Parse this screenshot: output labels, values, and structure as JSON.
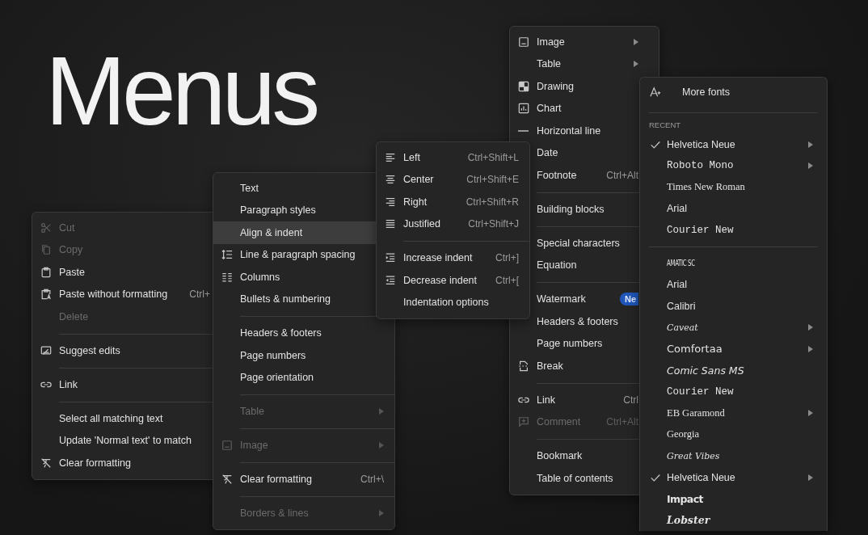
{
  "title": "Menus",
  "menus": [
    {
      "items": [
        {
          "kind": "item",
          "label": "Cut",
          "disabled": true
        },
        {
          "kind": "item",
          "label": "Copy",
          "disabled": true
        },
        {
          "kind": "item",
          "label": "Paste",
          "disabled": false
        },
        {
          "kind": "item",
          "label": "Paste without formatting",
          "shortcut": "Ctrl+",
          "disabled": false
        },
        {
          "kind": "item",
          "label": "Delete",
          "disabled": true
        },
        {
          "kind": "separator"
        },
        {
          "kind": "item",
          "label": "Suggest edits",
          "disabled": false
        },
        {
          "kind": "separator"
        },
        {
          "kind": "item",
          "label": "Link",
          "disabled": false
        },
        {
          "kind": "separator"
        },
        {
          "kind": "item",
          "label": "Select all matching text",
          "disabled": false
        },
        {
          "kind": "item",
          "label": "Update 'Normal text' to match",
          "disabled": false
        },
        {
          "kind": "item",
          "label": "Clear formatting",
          "disabled": false
        }
      ]
    },
    {
      "items": [
        {
          "kind": "item",
          "label": "Text",
          "disabled": false,
          "selected": false
        },
        {
          "kind": "item",
          "label": "Paragraph styles",
          "disabled": false,
          "selected": false
        },
        {
          "kind": "item",
          "label": "Align & indent",
          "disabled": false,
          "selected": true
        },
        {
          "kind": "item",
          "label": "Line & paragraph spacing",
          "disabled": false,
          "selected": false
        },
        {
          "kind": "item",
          "label": "Columns",
          "disabled": false,
          "selected": false
        },
        {
          "kind": "item",
          "label": "Bullets & numbering",
          "disabled": false,
          "selected": false
        },
        {
          "kind": "separator"
        },
        {
          "kind": "item",
          "label": "Headers & footers",
          "disabled": false,
          "selected": false
        },
        {
          "kind": "item",
          "label": "Page numbers",
          "disabled": false,
          "selected": false
        },
        {
          "kind": "item",
          "label": "Page orientation",
          "disabled": false,
          "selected": false
        },
        {
          "kind": "separator"
        },
        {
          "kind": "item",
          "label": "Table",
          "disabled": true,
          "selected": false,
          "submenu": true
        },
        {
          "kind": "separator"
        },
        {
          "kind": "item",
          "label": "Image",
          "disabled": true,
          "selected": false,
          "submenu": true
        },
        {
          "kind": "separator"
        },
        {
          "kind": "item",
          "label": "Clear formatting",
          "shortcut": "Ctrl+\\",
          "disabled": false,
          "selected": false
        },
        {
          "kind": "separator"
        },
        {
          "kind": "item",
          "label": "Borders & lines",
          "disabled": true,
          "selected": false,
          "submenu": true
        }
      ]
    },
    {
      "items": [
        {
          "kind": "item",
          "label": "Left",
          "shortcut": "Ctrl+Shift+L",
          "disabled": false
        },
        {
          "kind": "item",
          "label": "Center",
          "shortcut": "Ctrl+Shift+E",
          "disabled": false
        },
        {
          "kind": "item",
          "label": "Right",
          "shortcut": "Ctrl+Shift+R",
          "disabled": false
        },
        {
          "kind": "item",
          "label": "Justified",
          "shortcut": "Ctrl+Shift+J",
          "disabled": false
        },
        {
          "kind": "separator"
        },
        {
          "kind": "item",
          "label": "Increase indent",
          "shortcut": "Ctrl+]",
          "disabled": false
        },
        {
          "kind": "item",
          "label": "Decrease indent",
          "shortcut": "Ctrl+[",
          "disabled": false
        },
        {
          "kind": "item",
          "label": "Indentation options",
          "disabled": false
        }
      ]
    },
    {
      "items": [
        {
          "kind": "item",
          "label": "Image",
          "disabled": false,
          "submenu": true
        },
        {
          "kind": "item",
          "label": "Table",
          "disabled": false,
          "submenu": true
        },
        {
          "kind": "item",
          "label": "Drawing",
          "disabled": false
        },
        {
          "kind": "item",
          "label": "Chart",
          "disabled": false
        },
        {
          "kind": "item",
          "label": "Horizontal line",
          "disabled": false
        },
        {
          "kind": "item",
          "label": "Date",
          "disabled": false
        },
        {
          "kind": "item",
          "label": "Footnote",
          "shortcut": "Ctrl+Alt",
          "disabled": false
        },
        {
          "kind": "separator"
        },
        {
          "kind": "item",
          "label": "Building blocks",
          "disabled": false
        },
        {
          "kind": "separator"
        },
        {
          "kind": "item",
          "label": "Special characters",
          "disabled": false
        },
        {
          "kind": "item",
          "label": "Equation",
          "disabled": false
        },
        {
          "kind": "separator"
        },
        {
          "kind": "item",
          "label": "Watermark",
          "badge": "Ne",
          "disabled": false
        },
        {
          "kind": "item",
          "label": "Headers & footers",
          "disabled": false
        },
        {
          "kind": "item",
          "label": "Page numbers",
          "disabled": false
        },
        {
          "kind": "item",
          "label": "Break",
          "disabled": false
        },
        {
          "kind": "separator"
        },
        {
          "kind": "item",
          "label": "Link",
          "shortcut": "Ctrl",
          "disabled": false
        },
        {
          "kind": "item",
          "label": "Comment",
          "shortcut": "Ctrl+Alt",
          "disabled": true
        },
        {
          "kind": "separator"
        },
        {
          "kind": "item",
          "label": "Bookmark",
          "disabled": false
        },
        {
          "kind": "item",
          "label": "Table of contents",
          "disabled": false
        }
      ]
    },
    {
      "items": [
        {
          "kind": "large",
          "label": "More fonts",
          "disabled": false
        },
        {
          "kind": "separator"
        },
        {
          "kind": "header",
          "label": "RECENT"
        },
        {
          "kind": "sans",
          "label": "Helvetica Neue",
          "checked": true,
          "submenu": true,
          "disabled": false
        },
        {
          "kind": "mono",
          "label": "Roboto Mono",
          "checked": false,
          "submenu": true,
          "disabled": false
        },
        {
          "kind": "serif",
          "label": "Times New Roman",
          "checked": false,
          "disabled": false
        },
        {
          "kind": "sans",
          "label": "Arial",
          "checked": false,
          "disabled": false
        },
        {
          "kind": "mono",
          "label": "Courier New",
          "checked": false,
          "disabled": false
        },
        {
          "kind": "separator"
        },
        {
          "kind": "condensed",
          "label": "AMATIC SC",
          "checked": false,
          "disabled": false
        },
        {
          "kind": "sans",
          "label": "Arial",
          "checked": false,
          "disabled": false
        },
        {
          "kind": "sans",
          "label": "Calibri",
          "checked": false,
          "disabled": false
        },
        {
          "kind": "script",
          "label": "Caveat",
          "checked": false,
          "submenu": true,
          "disabled": false
        },
        {
          "kind": "rounded",
          "label": "Comfortaa",
          "checked": false,
          "submenu": true,
          "disabled": false
        },
        {
          "kind": "comic",
          "label": "Comic Sans MS",
          "checked": false,
          "disabled": false
        },
        {
          "kind": "mono",
          "label": "Courier New",
          "checked": false,
          "disabled": false
        },
        {
          "kind": "serif",
          "label": "EB Garamond",
          "checked": false,
          "submenu": true,
          "disabled": false
        },
        {
          "kind": "serif",
          "label": "Georgia",
          "checked": false,
          "disabled": false
        },
        {
          "kind": "script",
          "label": "Great Vibes",
          "checked": false,
          "disabled": false
        },
        {
          "kind": "sans",
          "label": "Helvetica Neue",
          "checked": true,
          "submenu": true,
          "disabled": false
        },
        {
          "kind": "heavy",
          "label": "Impact",
          "checked": false,
          "disabled": false
        },
        {
          "kind": "fancy",
          "label": "Lobster",
          "checked": false,
          "disabled": false
        }
      ]
    }
  ]
}
